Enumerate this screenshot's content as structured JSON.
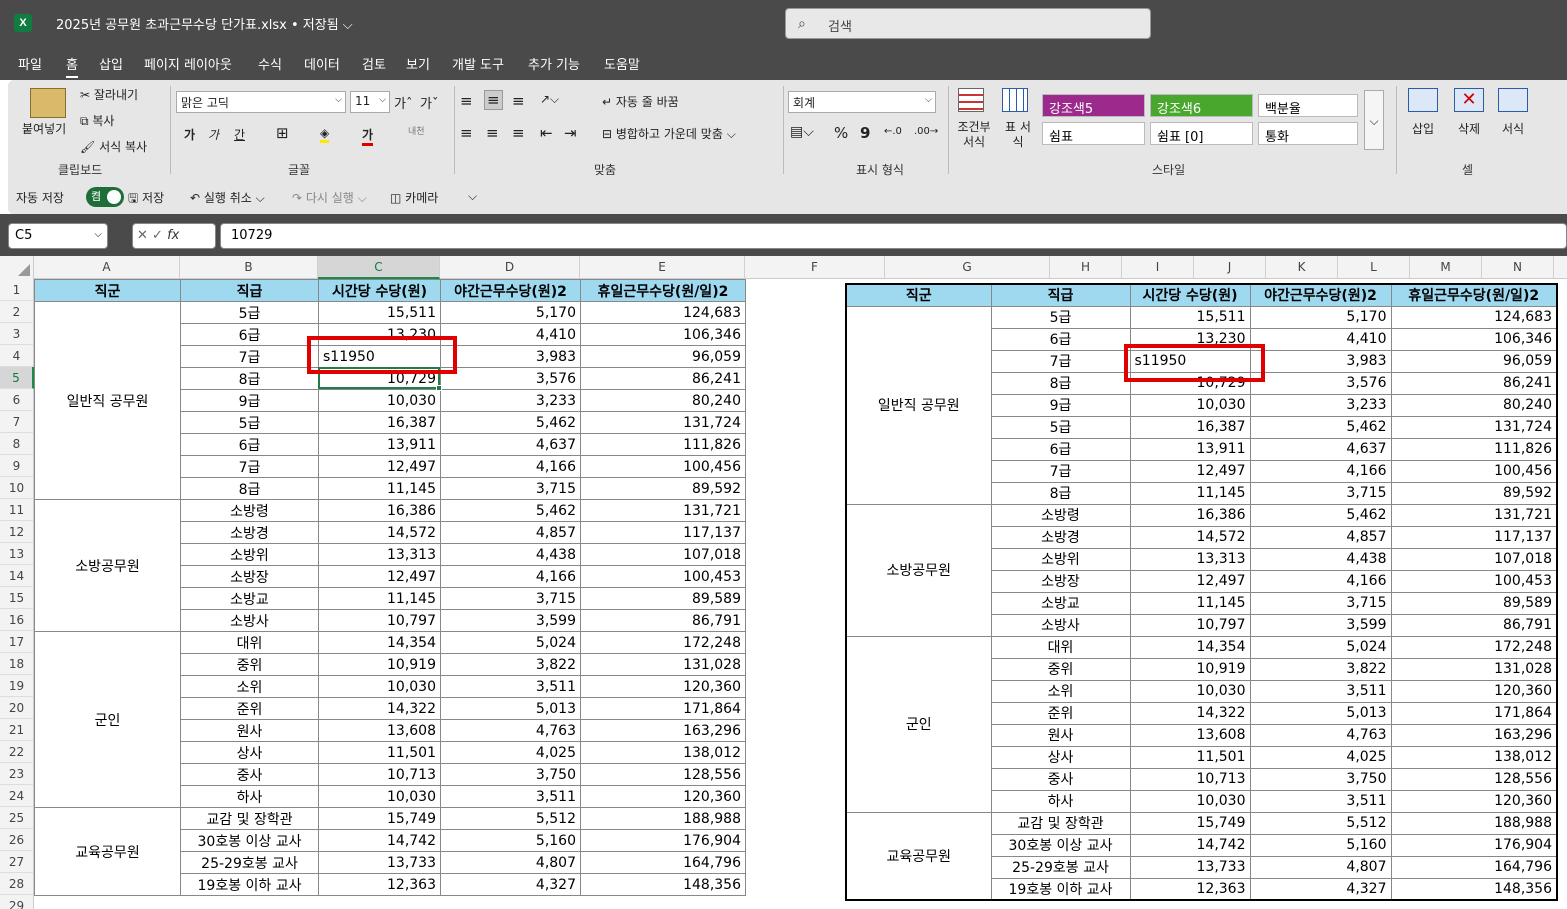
{
  "title": {
    "filename": "2025년 공무원 초과근무수당 단가표.xlsx • 저장됨 ⌵",
    "search": "검색",
    "app_icon": "X"
  },
  "menus": [
    "파일",
    "홈",
    "삽입",
    "페이지 레이아웃",
    "수식",
    "데이터",
    "검토",
    "보기",
    "개발 도구",
    "추가 기능",
    "도움말"
  ],
  "ribbon": {
    "paste": "붙여넣기",
    "cut": "잘라내기",
    "copy": "복사",
    "format_painter": "서식 복사",
    "clipboard": "클립보드",
    "font_name": "맑은 고딕",
    "font_size": "11",
    "font_group": "글꼴",
    "wrap": "자동 줄 바꿈",
    "merge": "병합하고 가운데 맞춤",
    "align_group": "맞춤",
    "num_format": "회계",
    "num_group": "표시 형식",
    "cond_format": "조건부 서식",
    "table_format": "표 서식",
    "styles": [
      "강조색5",
      "강조색6",
      "백분율",
      "쉼표",
      "쉼표 [0]",
      "통화"
    ],
    "styles_group": "스타일",
    "insert": "삽입",
    "delete": "삭제",
    "format": "서식",
    "cells_group": "셀"
  },
  "qat": {
    "autosave": "자동 저장",
    "toggle": "켬",
    "save": "저장",
    "undo": "실행 취소",
    "redo": "다시 실행",
    "camera": "카메라"
  },
  "formula_bar": {
    "namebox": "C5",
    "fx": "fx",
    "value": "10729"
  },
  "columns": [
    "A",
    "B",
    "C",
    "D",
    "E",
    "F",
    "G",
    "H",
    "I",
    "J",
    "K",
    "L",
    "M",
    "N"
  ],
  "rows": [
    "1",
    "2",
    "3",
    "4",
    "5",
    "6",
    "7",
    "8",
    "9",
    "10",
    "11",
    "12",
    "13",
    "14",
    "15",
    "16",
    "17",
    "18",
    "19",
    "20",
    "21",
    "22",
    "23",
    "24",
    "25",
    "26",
    "27",
    "28",
    "29"
  ],
  "table": {
    "headers": [
      "직군",
      "직급",
      "시간당 수당(원)",
      "야간근무수당(원)2",
      "휴일근무수당(원/일)2"
    ],
    "groups": [
      {
        "name": "일반직 공무원",
        "rows": [
          [
            "5급",
            "15,511",
            "5,170",
            "124,683"
          ],
          [
            "6급",
            "13,230",
            "4,410",
            "106,346"
          ],
          [
            "7급",
            "s11950",
            "3,983",
            "96,059"
          ],
          [
            "8급",
            "10,729",
            "3,576",
            "86,241"
          ],
          [
            "9급",
            "10,030",
            "3,233",
            "80,240"
          ],
          [
            "5급",
            "16,387",
            "5,462",
            "131,724"
          ],
          [
            "6급",
            "13,911",
            "4,637",
            "111,826"
          ],
          [
            "7급",
            "12,497",
            "4,166",
            "100,456"
          ],
          [
            "8급",
            "11,145",
            "3,715",
            "89,592"
          ]
        ]
      },
      {
        "name": "소방공무원",
        "rows": [
          [
            "소방령",
            "16,386",
            "5,462",
            "131,721"
          ],
          [
            "소방경",
            "14,572",
            "4,857",
            "117,137"
          ],
          [
            "소방위",
            "13,313",
            "4,438",
            "107,018"
          ],
          [
            "소방장",
            "12,497",
            "4,166",
            "100,453"
          ],
          [
            "소방교",
            "11,145",
            "3,715",
            "89,589"
          ],
          [
            "소방사",
            "10,797",
            "3,599",
            "86,791"
          ]
        ]
      },
      {
        "name": "군인",
        "rows": [
          [
            "대위",
            "14,354",
            "5,024",
            "172,248"
          ],
          [
            "중위",
            "10,919",
            "3,822",
            "131,028"
          ],
          [
            "소위",
            "10,030",
            "3,511",
            "120,360"
          ],
          [
            "준위",
            "14,322",
            "5,013",
            "171,864"
          ],
          [
            "원사",
            "13,608",
            "4,763",
            "163,296"
          ],
          [
            "상사",
            "11,501",
            "4,025",
            "138,012"
          ],
          [
            "중사",
            "10,713",
            "3,750",
            "128,556"
          ],
          [
            "하사",
            "10,030",
            "3,511",
            "120,360"
          ]
        ]
      },
      {
        "name": "교육공무원",
        "rows": [
          [
            "교감 및 장학관",
            "15,749",
            "5,512",
            "188,988"
          ],
          [
            "30호봉 이상 교사",
            "14,742",
            "5,160",
            "176,904"
          ],
          [
            "25-29호봉 교사",
            "13,733",
            "4,807",
            "164,796"
          ],
          [
            "19호봉 이하 교사",
            "12,363",
            "4,327",
            "148,356"
          ]
        ]
      }
    ]
  }
}
